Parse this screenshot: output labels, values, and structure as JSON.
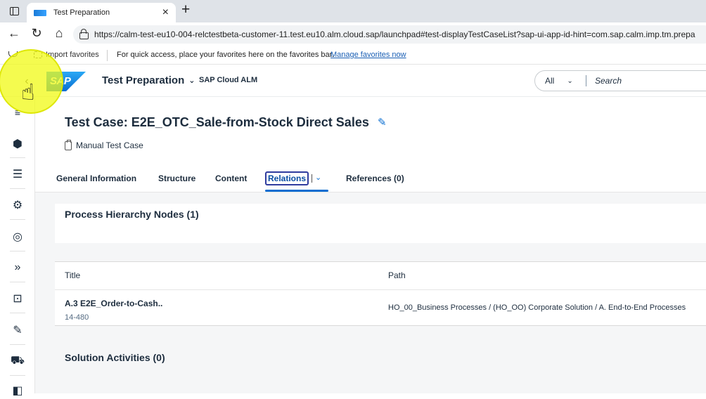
{
  "browser": {
    "tab_title": "Test Preparation",
    "tab_close": "×",
    "new_tab": "+",
    "url": "https://calm-test-eu10-004-relctestbeta-customer-11.test.eu10.alm.cloud.sap/launchpad#test-displayTestCaseList?sap-ui-app-id-hint=com.sap.calm.imp.tm.prepa",
    "nav_back": "←",
    "nav_reload": "↻",
    "nav_home": "⌂"
  },
  "favorites_bar": {
    "import_label": "Import favorites",
    "hint": "For quick access, place your favorites here on the favorites bar.",
    "manage_link": "Manage favorites now"
  },
  "shell": {
    "logo_text": "SAP",
    "app_title": "Test Preparation",
    "product": "SAP Cloud ALM",
    "search_scope": "All",
    "search_placeholder": "Search"
  },
  "page": {
    "title": "Test Case: E2E_OTC_Sale-from-Stock Direct Sales",
    "subtitle": "Manual Test Case"
  },
  "tabs": [
    {
      "label": "General Information"
    },
    {
      "label": "Structure"
    },
    {
      "label": "Content"
    },
    {
      "label": "Relations",
      "selected": true
    },
    {
      "label": "References (0)"
    }
  ],
  "sections": {
    "process_hierarchy": {
      "heading": "Process Hierarchy Nodes (1)",
      "columns": [
        "Title",
        "Path"
      ],
      "rows": [
        {
          "title": "A.3 E2E_Order-to-Cash..",
          "id": "14-480",
          "path": "HO_00_Business Processes / (HO_OO) Corporate Solution / A. End-to-End Processes"
        }
      ]
    },
    "solution_activities": {
      "heading": "Solution Activities (0)"
    }
  },
  "colors": {
    "accent": "#0a6ed1",
    "text": "#1d2d3e",
    "highlight": "#f0fa14"
  }
}
